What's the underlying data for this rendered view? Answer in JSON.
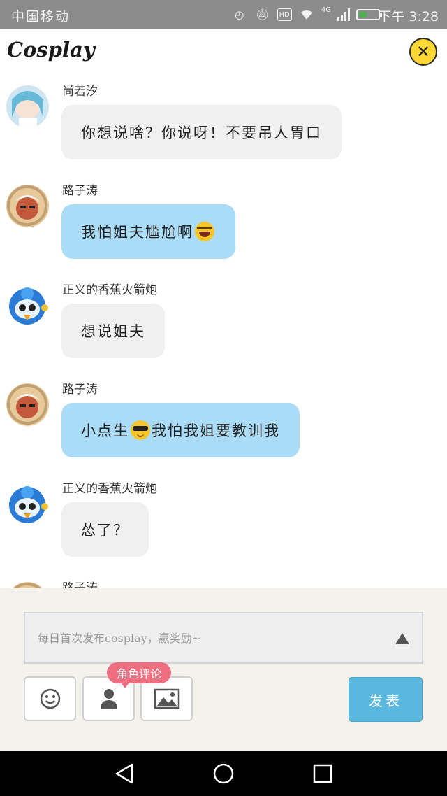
{
  "status_bar": {
    "carrier": "中国移动",
    "network": "4G",
    "hd": "HD",
    "time": "下午 3:28"
  },
  "header": {
    "title": "Cosplay",
    "close_icon": "close-icon"
  },
  "messages": [
    {
      "user": "尚若汐",
      "text": "你想说啥？你说呀！不要吊人胃口",
      "style": "gray",
      "emoji": ""
    },
    {
      "user": "路子涛",
      "text": "我怕姐夫尴尬啊",
      "style": "blue",
      "emoji": "laugh-emoji"
    },
    {
      "user": "正义的香蕉火箭炮",
      "text": "想说姐夫",
      "style": "gray",
      "emoji": ""
    },
    {
      "user": "路子涛",
      "text_before": "小点生",
      "text_after": "我怕我姐要教训我",
      "style": "blue",
      "emoji": "sunglasses-emoji"
    },
    {
      "user": "正义的香蕉火箭炮",
      "text": "怂了？",
      "style": "gray",
      "emoji": ""
    },
    {
      "user": "路子涛",
      "text": "",
      "style": "blue",
      "emoji": ""
    }
  ],
  "compose": {
    "placeholder": "每日首次发布cosplay，赢奖励~",
    "tooltip": "角色评论",
    "send_label": "发表",
    "tools": [
      "smiley-icon",
      "person-icon",
      "image-icon"
    ]
  },
  "colors": {
    "status_bar": "#8c8c8c",
    "close_button": "#fdd835",
    "bubble_gray": "#f0f0f0",
    "bubble_blue": "#aadcf8",
    "send_button": "#5ab8de",
    "tooltip": "#ee6f80"
  }
}
